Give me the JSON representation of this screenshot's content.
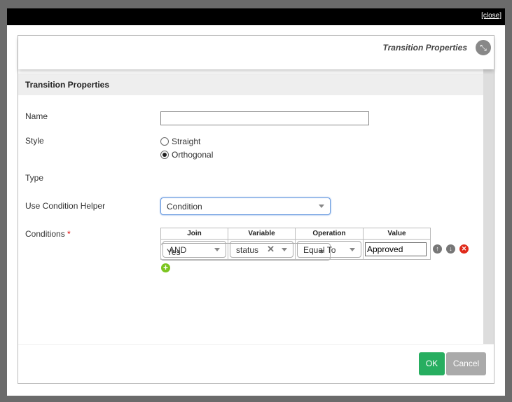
{
  "window": {
    "close_label": "[close]"
  },
  "panel": {
    "title": "Transition Properties",
    "section_title": "Transition Properties"
  },
  "form": {
    "name_label": "Name",
    "name_value": "",
    "style_label": "Style",
    "style_options": [
      "Straight",
      "Orthogonal"
    ],
    "style_selected": "Orthogonal",
    "type_label": "Type",
    "type_value": "Condition",
    "helper_label": "Use Condition Helper",
    "helper_value": "Yes",
    "conditions_label": "Conditions",
    "required_mark": "*",
    "conditions": {
      "headers": [
        "Join",
        "Variable",
        "Operation",
        "Value"
      ],
      "rows": [
        {
          "join": "AND",
          "variable": "status",
          "operation": "Equal To",
          "value": "Approved"
        }
      ]
    }
  },
  "footer": {
    "ok_label": "OK",
    "cancel_label": "Cancel"
  },
  "colors": {
    "ok": "#27ae60",
    "cancel": "#aaaaaa",
    "add": "#7cc520",
    "delete": "#e02a1a"
  }
}
